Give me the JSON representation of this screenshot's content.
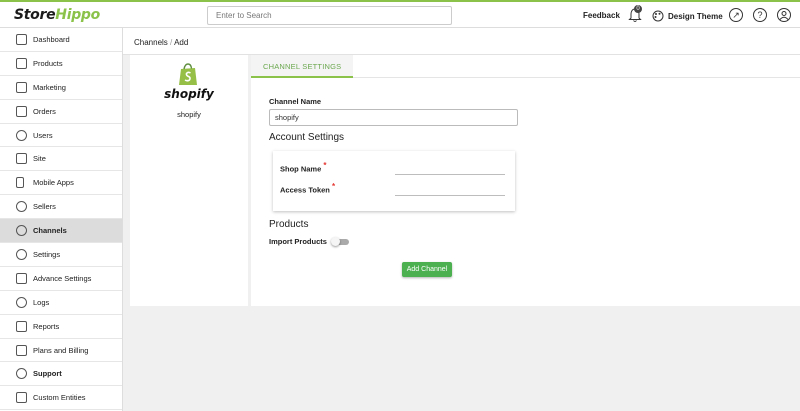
{
  "header": {
    "logo_prefix": "Store",
    "logo_suffix": "Hippo",
    "search_placeholder": "Enter to Search",
    "feedback_label": "Feedback",
    "notification_count": "0",
    "design_theme_label": "Design Theme",
    "accent_color": "#8bc34a"
  },
  "sidebar": {
    "items": [
      {
        "label": "Dashboard",
        "icon": "grid-icon"
      },
      {
        "label": "Products",
        "icon": "clipboard-icon"
      },
      {
        "label": "Marketing",
        "icon": "megaphone-icon"
      },
      {
        "label": "Orders",
        "icon": "document-icon"
      },
      {
        "label": "Users",
        "icon": "user-icon"
      },
      {
        "label": "Site",
        "icon": "brush-icon"
      },
      {
        "label": "Mobile Apps",
        "icon": "mobile-icon"
      },
      {
        "label": "Sellers",
        "icon": "sellers-icon"
      },
      {
        "label": "Channels",
        "icon": "channels-icon",
        "active": true
      },
      {
        "label": "Settings",
        "icon": "gear-icon"
      },
      {
        "label": "Advance Settings",
        "icon": "advance-settings-icon"
      },
      {
        "label": "Logs",
        "icon": "clock-icon"
      },
      {
        "label": "Reports",
        "icon": "chart-icon"
      },
      {
        "label": "Plans and Billing",
        "icon": "billing-icon"
      },
      {
        "label": "Support",
        "icon": "headset-icon"
      },
      {
        "label": "Custom Entities",
        "icon": "entities-icon"
      }
    ]
  },
  "breadcrumb": {
    "parent": "Channels",
    "current": "Add"
  },
  "channel": {
    "logo_word": "shopify",
    "name": "shopify"
  },
  "form": {
    "tab_label": "CHANNEL SETTINGS",
    "channel_name_label": "Channel Name",
    "channel_name_value": "shopify",
    "account_settings_title": "Account Settings",
    "shop_name_label": "Shop Name",
    "shop_name_value": "",
    "access_token_label": "Access Token",
    "access_token_value": "",
    "required_mark": "*",
    "products_title": "Products",
    "import_products_label": "Import Products",
    "import_products_enabled": false,
    "submit_label": "Add Channel"
  }
}
